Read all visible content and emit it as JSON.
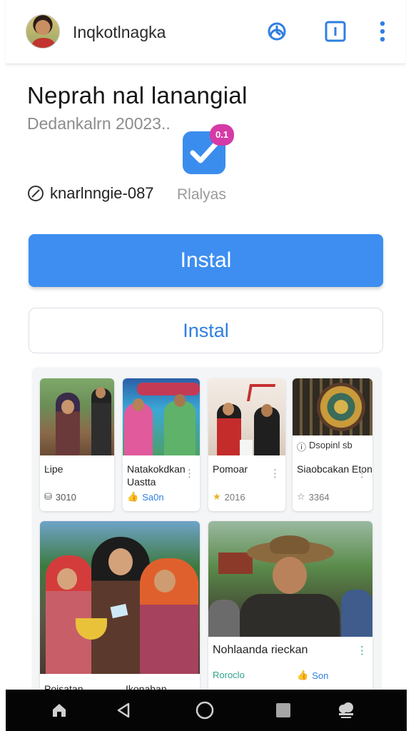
{
  "header": {
    "title": "Inqkotlnagka",
    "icons": [
      "clock-icon",
      "square-icon",
      "more-icon"
    ]
  },
  "app": {
    "name": "Neprah nal lanangial",
    "date": "Dedankalrn 20023..",
    "badge": "0.1",
    "developer": "knarlnngie-087",
    "category": "Rlalyas",
    "primary_button": "Instal",
    "secondary_button": "Instal"
  },
  "gallery": {
    "cards": [
      {
        "title": "Ŀipe",
        "meta": "3010",
        "meta_icon": "download-icon"
      },
      {
        "title": "Natakokdkan Uastta",
        "meta": "Sa0n",
        "meta_icon": "thumb-icon"
      },
      {
        "title": "Pomoar",
        "meta": "2016",
        "meta_icon": "star-icon"
      },
      {
        "title": "Siaobcakan Eton",
        "meta": "3364",
        "meta_icon": "star-icon",
        "caption": "Dsopinl sb"
      },
      {
        "title": "Poisatan",
        "meta": ""
      },
      {
        "title": "Ikonahan",
        "meta": ""
      },
      {
        "title": "Nohlaanda rieckan",
        "meta": "Roroclo",
        "meta_right": "Son"
      }
    ]
  },
  "colors": {
    "accent": "#3d8ef0",
    "text_primary": "#151515",
    "text_muted": "#8c8c8c",
    "badge": "#d63aa6",
    "nav": "#050505"
  }
}
